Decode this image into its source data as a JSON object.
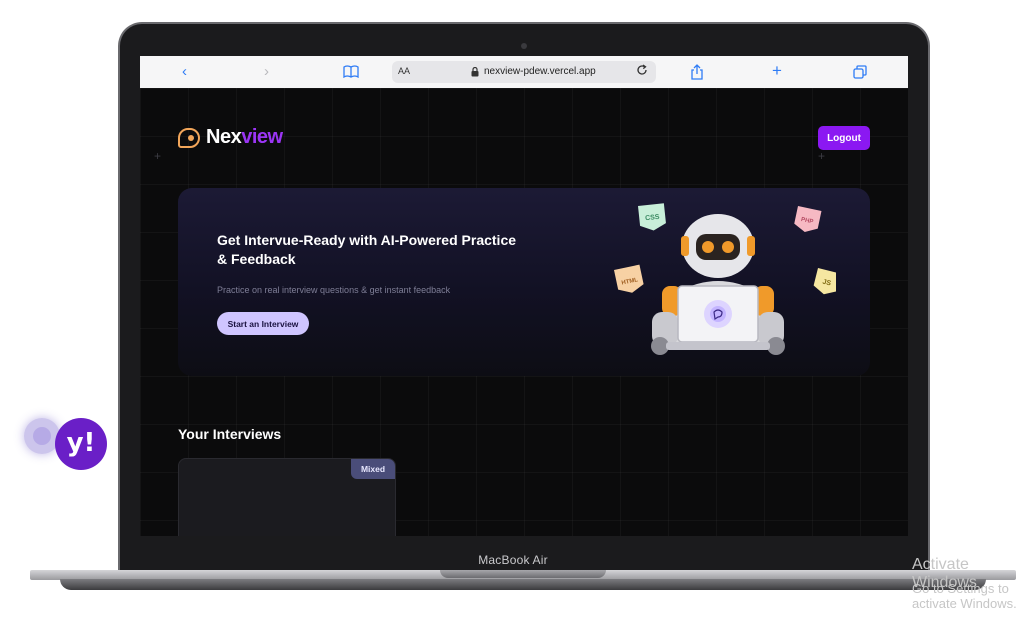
{
  "device": {
    "label": "MacBook Air"
  },
  "browser": {
    "text_size_label": "AA",
    "url": "nexview-pdew.vercel.app",
    "back_icon": "‹",
    "forward_icon": "›",
    "bookmarks_icon": "book-icon",
    "share_icon": "share-icon",
    "new_tab_icon": "+",
    "tabs_icon": "tabs-icon"
  },
  "header": {
    "logo_primary": "Nex",
    "logo_accent": "view",
    "logout_label": "Logout"
  },
  "hero": {
    "title": "Get Intervue-Ready with AI-Powered Practice & Feedback",
    "subtitle": "Practice on real interview questions & get instant feedback",
    "cta_label": "Start an Interview",
    "tech_badges": [
      "CSS",
      "PHP",
      "HTML",
      "JS"
    ]
  },
  "interviews": {
    "section_title": "Your Interviews",
    "cards": [
      {
        "badge": "Mixed",
        "logo_text": "y!"
      }
    ]
  },
  "overlay": {
    "watermark_title": "Activate Windows",
    "watermark_subtitle": "Go to Settings to activate Windows."
  },
  "colors": {
    "accent": "#8b18f2",
    "logo_accent": "#9b35f5",
    "cta_bg": "#cfc5ff",
    "logo_mark": "#f2a65a",
    "badge_bg": "#4a4d79",
    "yahoo_purple": "#6a1fc7"
  }
}
